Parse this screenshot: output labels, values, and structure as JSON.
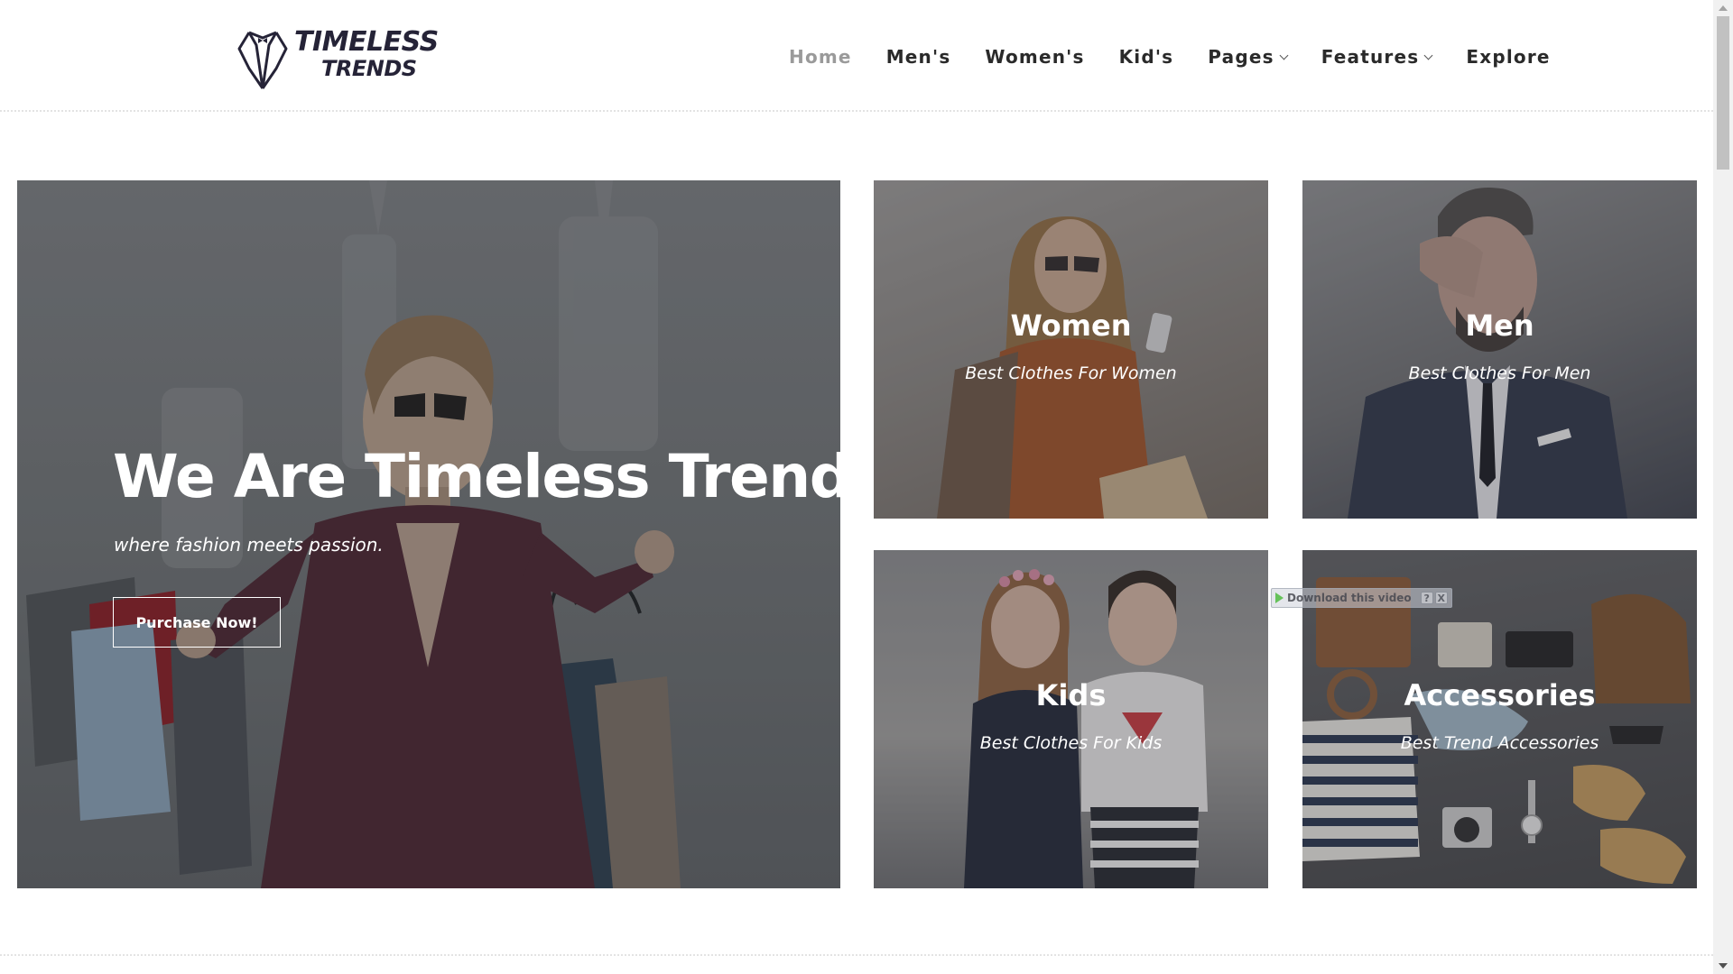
{
  "brand": {
    "logo_line1": "TIMELESS",
    "logo_line2": "TRENDS",
    "logo_icon": "tuxedo-collar-icon",
    "color": "#252337"
  },
  "nav": {
    "items": [
      {
        "label": "Home",
        "active": true
      },
      {
        "label": "Men's",
        "active": false
      },
      {
        "label": "Women's",
        "active": false
      },
      {
        "label": "Kid's",
        "active": false
      },
      {
        "label": "Pages",
        "active": false,
        "dropdown": true
      },
      {
        "label": "Features",
        "active": false,
        "dropdown": true
      },
      {
        "label": "Explore",
        "active": false
      }
    ],
    "active_color": "#9a9a9a",
    "text_color": "#2a2a2a"
  },
  "hero": {
    "title": "We Are Timeless Trends",
    "subtitle": "where fashion meets passion.",
    "button_label": "Purchase Now!"
  },
  "categories": [
    {
      "title": "Women",
      "subtitle": "Best Clothes For Women"
    },
    {
      "title": "Men",
      "subtitle": "Best Clothes For Men"
    },
    {
      "title": "Kids",
      "subtitle": "Best Clothes For Kids"
    },
    {
      "title": "Accessories",
      "subtitle": "Best Trend Accessories"
    }
  ],
  "video_download": {
    "label": "Download this video",
    "help": "?",
    "close": "X"
  }
}
